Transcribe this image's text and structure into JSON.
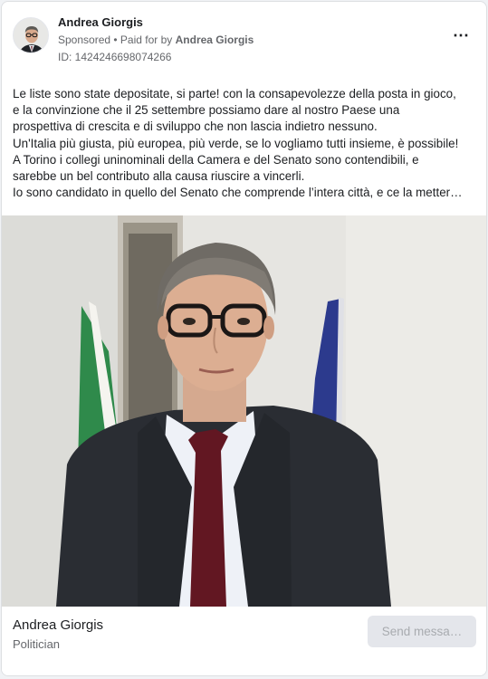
{
  "ad": {
    "advertiser": "Andrea Giorgis",
    "sponsored_label": "Sponsored",
    "paid_for_prefix": " • Paid for by ",
    "paid_for_by": "Andrea Giorgis",
    "library_id": "ID: 1424246698074266",
    "more_icon": "⋯"
  },
  "body": {
    "lines": [
      "Le liste sono state depositate, si parte! con la consapevolezze della posta in gioco,",
      "e la convinzione che il 25 settembre possiamo dare al nostro Paese una",
      "prospettiva di crescita e di sviluppo che non lascia indietro nessuno.",
      "Un'Italia più giusta, più europea, più verde, se lo vogliamo tutti insieme, è possibile!",
      "A Torino i collegi uninominali della Camera e del Senato sono contendibili, e",
      "sarebbe un bel contributo alla causa riuscire a vincerli.",
      "Io sono candidato in quello del Senato che comprende l’intera città, e ce la metter…"
    ]
  },
  "footer": {
    "page_name": "Andrea Giorgis",
    "page_category": "Politician",
    "cta_label": "Send messa…"
  },
  "colors": {
    "text": "#1c1e21",
    "secondary": "#65676b",
    "cta_bg": "#e4e6eb",
    "cta_text": "#a8abaf"
  }
}
